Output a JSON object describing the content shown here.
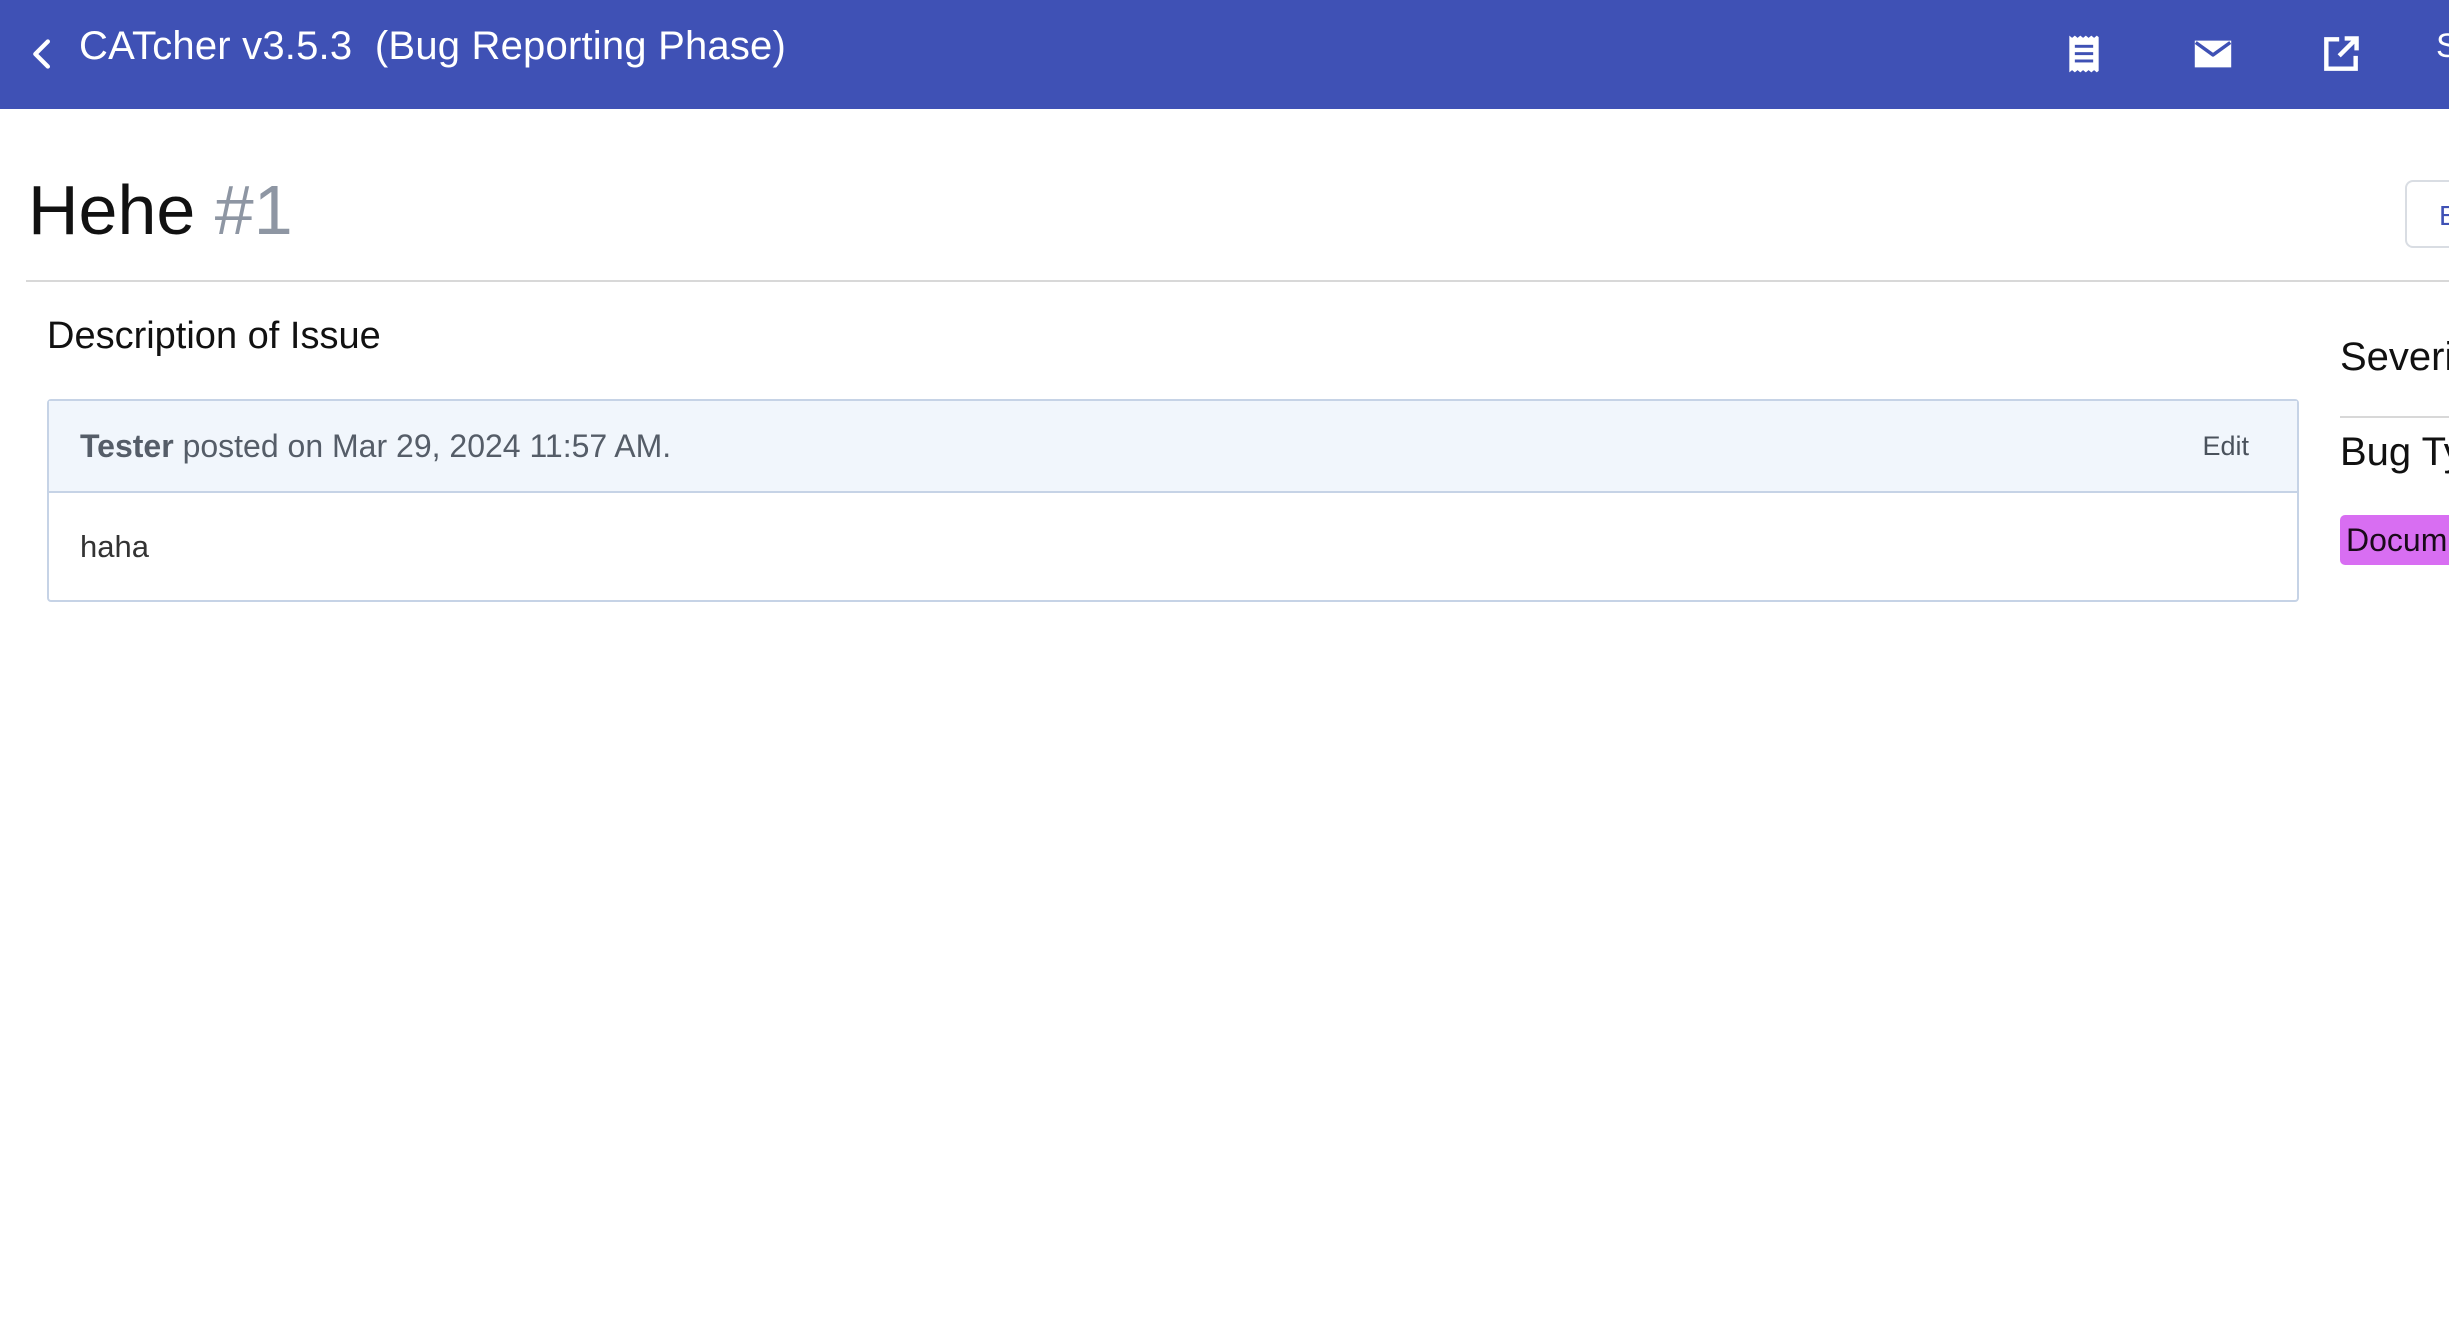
{
  "header": {
    "title": "CATcher v3.5.3  (Bug Reporting Phase)",
    "icons": [
      "back-arrow-icon",
      "document-list-icon",
      "mail-icon",
      "open-external-icon"
    ],
    "overflow_text": "S",
    "color": "#3f51b5"
  },
  "issue": {
    "title": "Hehe",
    "number": "#1",
    "edit_button_label": "E"
  },
  "description": {
    "heading": "Description of Issue",
    "comment": {
      "author": "Tester",
      "meta_text": " posted on Mar 29, 2024 11:57 AM.",
      "edit_label": "Edit",
      "body": "haha"
    }
  },
  "sidebar": {
    "severity_label": "Severi",
    "bug_type_label": "Bug Ty",
    "bug_type_value": "Docum",
    "bug_type_color": "#d86ef2"
  }
}
